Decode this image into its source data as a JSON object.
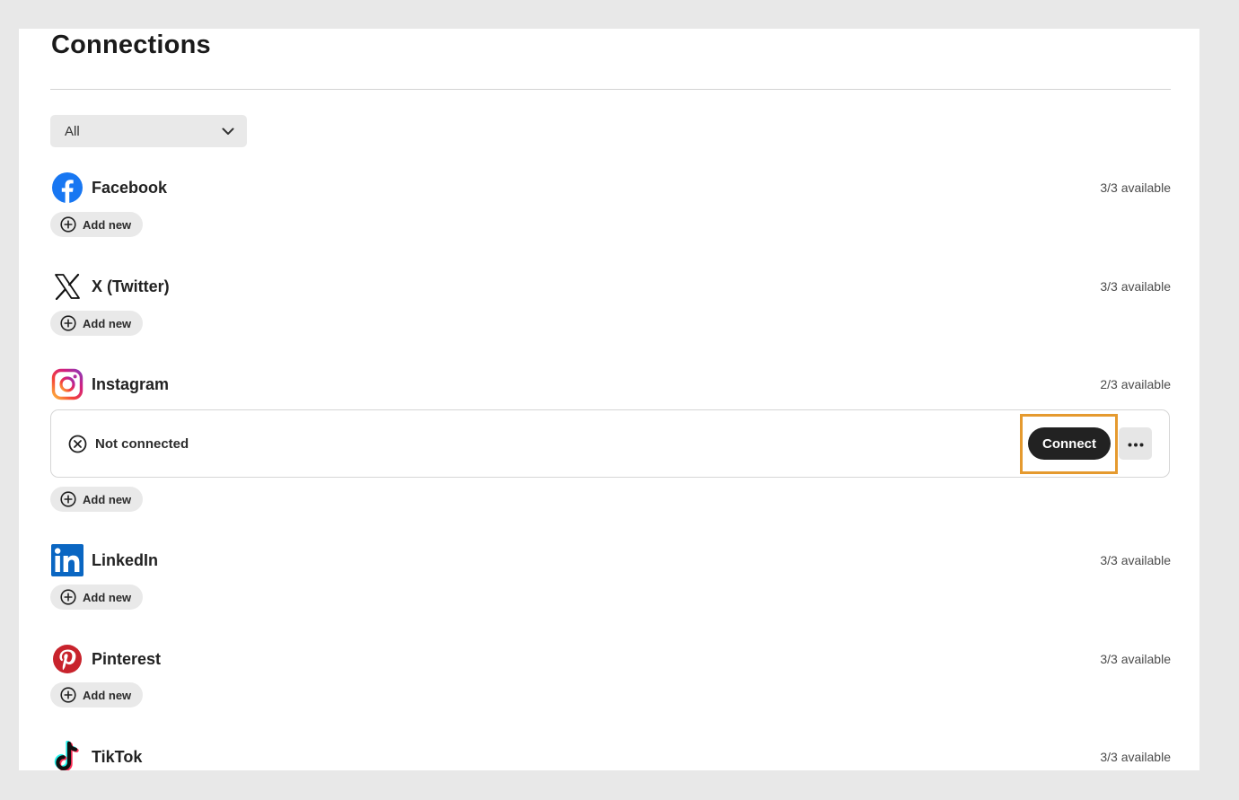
{
  "page": {
    "title": "Connections"
  },
  "filter": {
    "selected": "All",
    "icon": "chevron-down-icon"
  },
  "add_new_label": "Add new",
  "platforms": [
    {
      "name": "Facebook",
      "icon": "facebook-icon",
      "availability": "3/3 available"
    },
    {
      "name": "X (Twitter)",
      "icon": "x-twitter-icon",
      "availability": "3/3 available"
    },
    {
      "name": "Instagram",
      "icon": "instagram-icon",
      "availability": "2/3 available",
      "accounts": [
        {
          "status": "Not connected",
          "status_icon": "x-circle-icon",
          "connect_label": "Connect",
          "more_icon": "ellipsis-icon"
        }
      ]
    },
    {
      "name": "LinkedIn",
      "icon": "linkedin-icon",
      "availability": "3/3 available"
    },
    {
      "name": "Pinterest",
      "icon": "pinterest-icon",
      "availability": "3/3 available"
    },
    {
      "name": "TikTok",
      "icon": "tiktok-icon",
      "availability": "3/3 available"
    }
  ],
  "colors": {
    "facebook": "#1877f2",
    "linkedin": "#0a66c2",
    "pinterest": "#c8232c",
    "highlight": "#e59a2f",
    "connect_button": "#222222"
  }
}
